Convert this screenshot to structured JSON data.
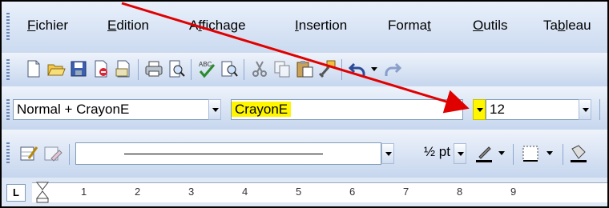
{
  "menu": {
    "items": [
      {
        "label": "Fichier",
        "m": "F",
        "rest": "ichier"
      },
      {
        "label": "Edition",
        "m": "E",
        "rest": "dition"
      },
      {
        "label": "Affichage",
        "pre": "A",
        "m": "f",
        "rest": "fichage"
      },
      {
        "label": "Insertion",
        "m": "I",
        "rest": "nsertion"
      },
      {
        "label": "Format",
        "pre": "Forma",
        "m": "t",
        "rest": ""
      },
      {
        "label": "Outils",
        "m": "O",
        "rest": "utils"
      },
      {
        "label": "Tableau",
        "pre": "Ta",
        "m": "b",
        "rest": "leau"
      }
    ]
  },
  "toolbar_standard": {
    "icons": [
      "new-document-icon",
      "open-folder-icon",
      "save-icon",
      "permission-icon",
      "email-icon",
      "print-icon",
      "print-preview-icon",
      "spelling-icon",
      "research-icon",
      "cut-icon",
      "copy-icon",
      "paste-icon",
      "format-painter-icon",
      "undo-icon",
      "undo-dropdown-icon",
      "redo-icon"
    ]
  },
  "toolbar_formatting": {
    "style_value": "Normal + CrayonE",
    "font_value": "CrayonE",
    "size_value": "12"
  },
  "toolbar_drawing": {
    "line_weight": "½ pt"
  },
  "ruler": {
    "tab_marker": "L",
    "numbers": [
      "1",
      "2",
      "3",
      "4",
      "5",
      "6",
      "7",
      "8",
      "9"
    ]
  },
  "colors": {
    "highlight": "#fff600",
    "arrow": "#e00000"
  }
}
